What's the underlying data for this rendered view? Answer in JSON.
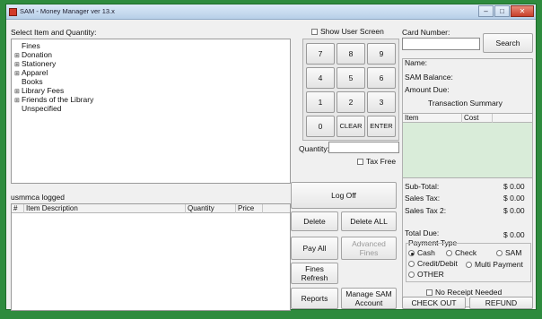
{
  "window": {
    "title": "SAM - Money Manager ver 13.x"
  },
  "tree": {
    "label": "Select Item and Quantity:",
    "items": [
      {
        "label": "Fines",
        "expandable": false
      },
      {
        "label": "Donation",
        "expandable": true
      },
      {
        "label": "Stationery",
        "expandable": true
      },
      {
        "label": "Apparel",
        "expandable": true
      },
      {
        "label": "Books",
        "expandable": false
      },
      {
        "label": "Library Fees",
        "expandable": true
      },
      {
        "label": "Friends of the Library",
        "expandable": true
      },
      {
        "label": "Unspecified",
        "expandable": false
      }
    ]
  },
  "status": {
    "logged": "usmmca logged"
  },
  "items_table": {
    "columns": [
      "#",
      "Item Description",
      "Quantity",
      "Price"
    ],
    "rows": []
  },
  "keypad": {
    "show_user_screen": "Show User Screen",
    "keys": [
      "7",
      "8",
      "9",
      "4",
      "5",
      "6",
      "1",
      "2",
      "3",
      "0",
      "CLEAR",
      "ENTER"
    ],
    "quantity_label": "Quantity:",
    "quantity_value": "",
    "tax_free": "Tax Free"
  },
  "actions": {
    "log_off": "Log Off",
    "delete": "Delete",
    "delete_all": "Delete ALL",
    "pay_all": "Pay All",
    "advanced_fines_1": "Advanced",
    "advanced_fines_2": "Fines",
    "fines_refresh_1": "Fines",
    "fines_refresh_2": "Refresh",
    "reports": "Reports",
    "manage_sam_1": "Manage SAM",
    "manage_sam_2": "Account"
  },
  "card": {
    "label": "Card Number:",
    "value": "",
    "search": "Search",
    "name_label": "Name:",
    "balance_label": "SAM Balance:",
    "amount_due_label": "Amount Due:"
  },
  "summary": {
    "title": "Transaction Summary",
    "columns": [
      "Item",
      "Cost"
    ],
    "subtotal_label": "Sub-Total:",
    "subtotal": "$ 0.00",
    "sales_tax_label": "Sales Tax:",
    "sales_tax": "$ 0.00",
    "sales_tax2_label": "Sales Tax 2:",
    "sales_tax2": "$ 0.00",
    "total_label": "Total Due:",
    "total": "$ 0.00"
  },
  "payment": {
    "label": "Payment Type",
    "cash": "Cash",
    "check": "Check",
    "sam": "SAM",
    "credit": "Credit/Debit",
    "multi": "Multi Payment",
    "other": "OTHER",
    "selected": "Cash"
  },
  "checkout": {
    "no_receipt": "No Receipt Needed",
    "check_out": "CHECK OUT",
    "refund": "REFUND"
  },
  "colors": {
    "background": "#2e8b3e",
    "summary_list": "#d9ecd9"
  }
}
